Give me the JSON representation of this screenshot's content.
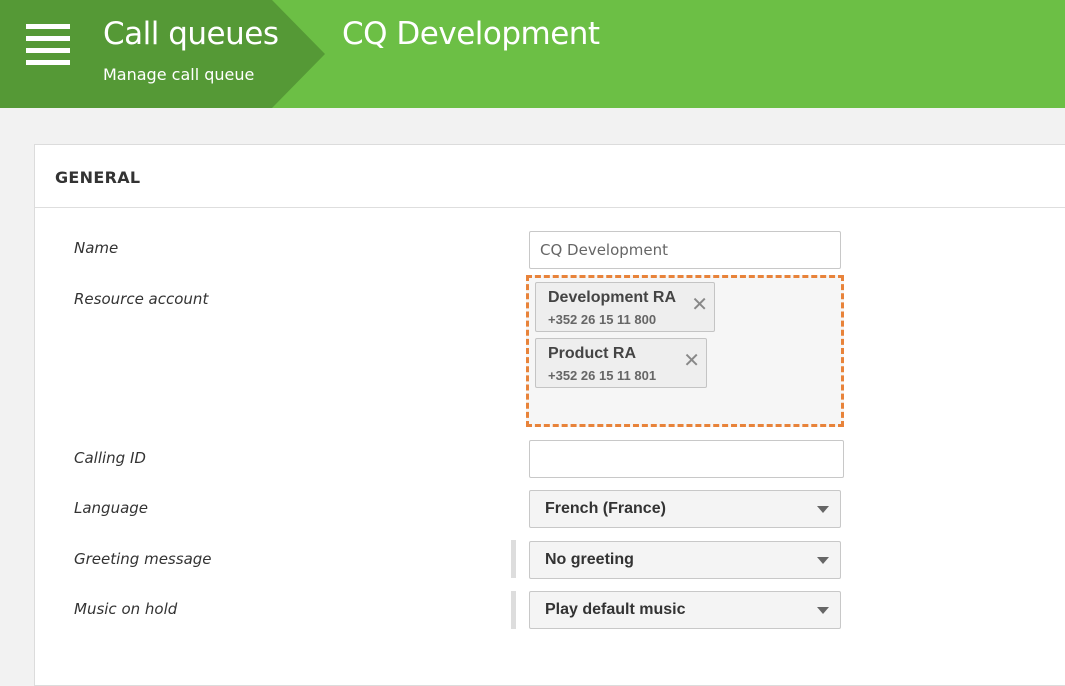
{
  "header": {
    "section_title": "Call queues",
    "section_subtitle": "Manage call queue",
    "page_title": "CQ Development"
  },
  "colors": {
    "header_green": "#6cbf45",
    "crumb_green": "#559936",
    "highlight_orange": "#e8833a"
  },
  "card": {
    "title": "GENERAL"
  },
  "form": {
    "name": {
      "label": "Name",
      "value": "CQ Development"
    },
    "resource_account": {
      "label": "Resource account",
      "items": [
        {
          "name": "Development RA",
          "phone": "+352 26 15 11 800"
        },
        {
          "name": "Product RA",
          "phone": "+352 26 15 11 801"
        }
      ]
    },
    "calling_id": {
      "label": "Calling ID",
      "value": ""
    },
    "language": {
      "label": "Language",
      "value": "French (France)"
    },
    "greeting_message": {
      "label": "Greeting message",
      "value": "No greeting"
    },
    "music_on_hold": {
      "label": "Music on hold",
      "value": "Play default music"
    }
  }
}
